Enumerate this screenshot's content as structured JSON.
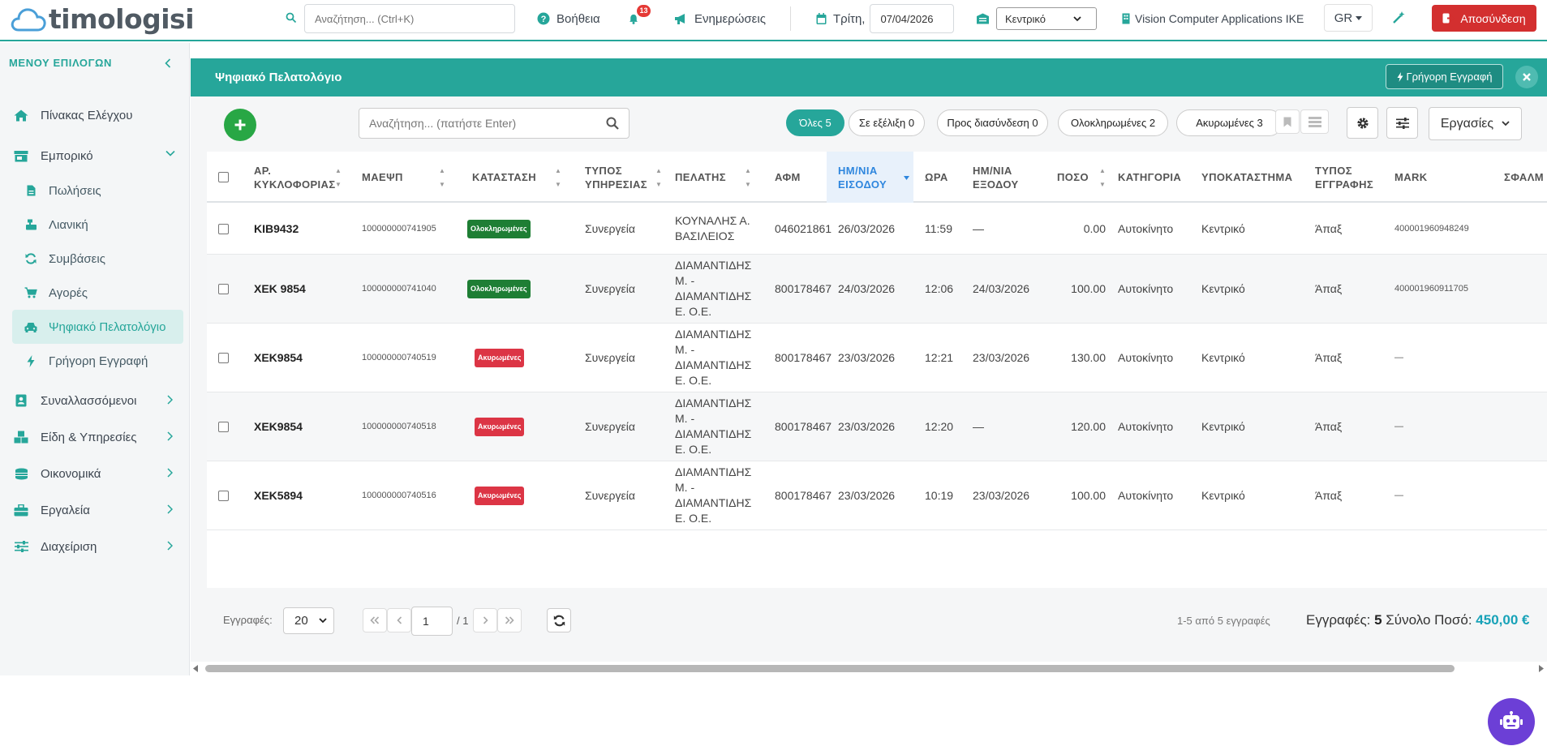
{
  "app": {
    "logo_text": "timologisi"
  },
  "topbar": {
    "search_placeholder": "Αναζήτηση... (Ctrl+K)",
    "help_label": "Βοήθεια",
    "notifications_count": "13",
    "updates_label": "Ενημερώσεις",
    "day_label": "Τρίτη,",
    "date_value": "07/04/2026",
    "branch_value": "Κεντρικό",
    "company_name": "Vision Computer Applications IKE",
    "language": "GR",
    "logout_label": "Αποσύνδεση"
  },
  "sidebar": {
    "title": "ΜΕΝΟΥ ΕΠΙΛΟΓΩΝ",
    "dashboard": "Πίνακας Ελέγχου",
    "commerce": "Εμπορικό",
    "sub_items": [
      "Πωλήσεις",
      "Λιανική",
      "Συμβάσεις",
      "Αγορές",
      "Ψηφιακό Πελατολόγιο",
      "Γρήγορη Εγγραφή"
    ],
    "groups": [
      "Συναλλασσόμενοι",
      "Είδη & Υπηρεσίες",
      "Οικονομικά",
      "Εργαλεία",
      "Διαχείριση"
    ]
  },
  "main": {
    "title": "Ψηφιακό Πελατολόγιο",
    "quick_entry": "Γρήγορη Εγγραφή",
    "search_placeholder": "Αναζήτηση... (πατήστε Enter)",
    "filters": [
      "Όλες 5",
      "Σε εξέλιξη 0",
      "Προς διασύνδεση 0",
      "Ολοκληρωμένες 2",
      "Ακυρωμένες 3"
    ],
    "actions_label": "Εργασίες"
  },
  "table": {
    "columns": [
      "ΑΡ. ΚΥΚΛΟΦΟΡΙΑΣ",
      "ΜΑΕΨΠ",
      "ΚΑΤΑΣΤΑΣΗ",
      "ΤΥΠΟΣ ΥΠΗΡΕΣΙΑΣ",
      "ΠΕΛΑΤΗΣ",
      "ΑΦΜ",
      "ΗΜ/ΝΙΑ ΕΙΣΟΔΟΥ",
      "ΩΡΑ",
      "ΗΜ/ΝΙΑ ΕΞΟΔΟΥ",
      "ΠΟΣΟ",
      "ΚΑΤΗΓΟΡΙΑ",
      "ΥΠΟΚΑΤΑΣΤΗΜΑ",
      "ΤΥΠΟΣ ΕΓΓΡΑΦΗΣ",
      "MARK",
      "ΣΦΑΛΜ"
    ],
    "rows": [
      {
        "plate": "KIB9432",
        "maepsp": "100000000741905",
        "status": "Ολοκληρωμένες",
        "status_color": "#1e7e34",
        "service": "Συνεργεία",
        "client": "ΚΟΥΝΑΛΗΣ Α. ΒΑΣΙΛΕΙΟΣ",
        "afm": "046021861",
        "date_in": "26/03/2026",
        "time": "11:59",
        "date_out": "—",
        "amount": "0.00",
        "category": "Αυτοκίνητο",
        "branch": "Κεντρικό",
        "entry_type": "Άπαξ",
        "mark": "400001960948249"
      },
      {
        "plate": "XEK 9854",
        "maepsp": "100000000741040",
        "status": "Ολοκληρωμένες",
        "status_color": "#1e7e34",
        "service": "Συνεργεία",
        "client": "ΔΙΑΜΑΝΤΙΔΗΣ Μ. - ΔΙΑΜΑΝΤΙΔΗΣ Ε. Ο.Ε.",
        "afm": "800178467",
        "date_in": "24/03/2026",
        "time": "12:06",
        "date_out": "24/03/2026",
        "amount": "100.00",
        "category": "Αυτοκίνητο",
        "branch": "Κεντρικό",
        "entry_type": "Άπαξ",
        "mark": "400001960911705"
      },
      {
        "plate": "XEK9854",
        "maepsp": "100000000740519",
        "status": "Ακυρωμένες",
        "status_color": "#dc3545",
        "service": "Συνεργεία",
        "client": "ΔΙΑΜΑΝΤΙΔΗΣ Μ. - ΔΙΑΜΑΝΤΙΔΗΣ Ε. Ο.Ε.",
        "afm": "800178467",
        "date_in": "23/03/2026",
        "time": "12:21",
        "date_out": "23/03/2026",
        "amount": "130.00",
        "category": "Αυτοκίνητο",
        "branch": "Κεντρικό",
        "entry_type": "Άπαξ",
        "mark": "—"
      },
      {
        "plate": "XEK9854",
        "maepsp": "100000000740518",
        "status": "Ακυρωμένες",
        "status_color": "#dc3545",
        "service": "Συνεργεία",
        "client": "ΔΙΑΜΑΝΤΙΔΗΣ Μ. - ΔΙΑΜΑΝΤΙΔΗΣ Ε. Ο.Ε.",
        "afm": "800178467",
        "date_in": "23/03/2026",
        "time": "12:20",
        "date_out": "—",
        "amount": "120.00",
        "category": "Αυτοκίνητο",
        "branch": "Κεντρικό",
        "entry_type": "Άπαξ",
        "mark": "—"
      },
      {
        "plate": "XEK5894",
        "maepsp": "100000000740516",
        "status": "Ακυρωμένες",
        "status_color": "#dc3545",
        "service": "Συνεργεία",
        "client": "ΔΙΑΜΑΝΤΙΔΗΣ Μ. - ΔΙΑΜΑΝΤΙΔΗΣ Ε. Ο.Ε.",
        "afm": "800178467",
        "date_in": "23/03/2026",
        "time": "10:19",
        "date_out": "23/03/2026",
        "amount": "100.00",
        "category": "Αυτοκίνητο",
        "branch": "Κεντρικό",
        "entry_type": "Άπαξ",
        "mark": "—"
      }
    ]
  },
  "footer": {
    "page_size_label": "Εγγραφές:",
    "page_size": "20",
    "page": "1",
    "page_total": "/ 1",
    "range_text": "1-5 από 5 εγγραφές",
    "records_label": "Εγγραφές:",
    "records_count": "5",
    "sum_label": "Σύνολο Ποσό:",
    "sum_amount": "450,00 €"
  },
  "colors": {
    "accent": "#26a69a",
    "danger": "#d32f2f",
    "success": "#28a745",
    "bot": "#6c3fd6"
  }
}
